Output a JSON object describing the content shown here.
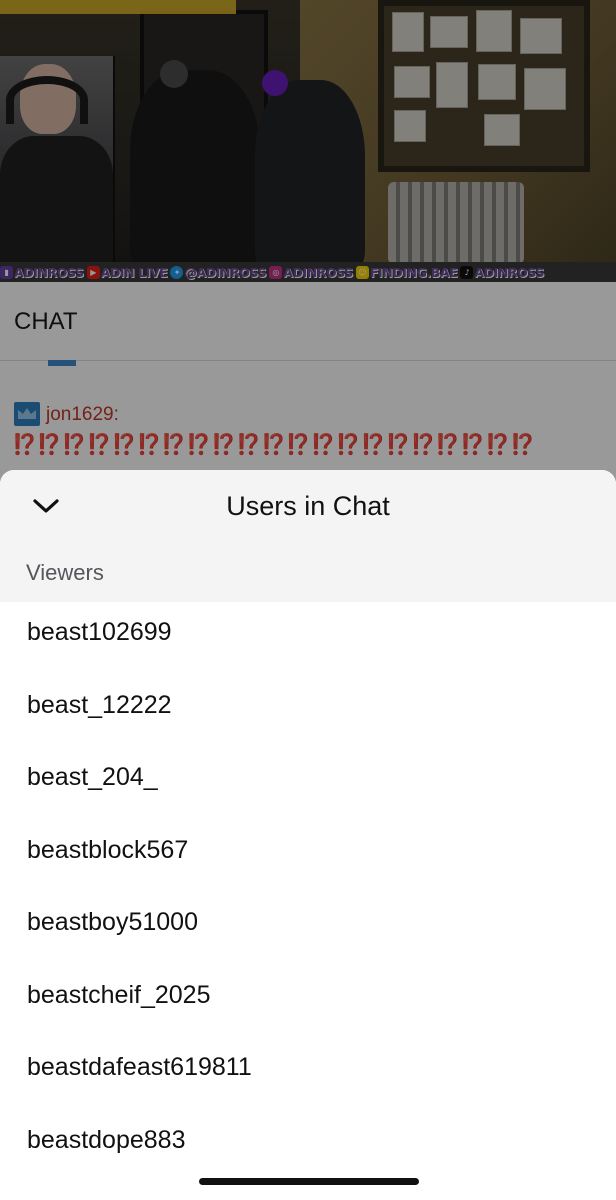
{
  "social_bar": {
    "items": [
      {
        "icon": "twitch-icon",
        "label": "ADINROSS"
      },
      {
        "icon": "youtube-icon",
        "label": "ADIN LIVE"
      },
      {
        "icon": "twitter-icon",
        "label": "@ADINROSS"
      },
      {
        "icon": "instagram-icon",
        "label": "ADINROSS"
      },
      {
        "icon": "snapchat-icon",
        "label": "FINDING.BAE"
      },
      {
        "icon": "tiktok-icon",
        "label": "ADINROSS"
      }
    ]
  },
  "chat": {
    "title": "CHAT",
    "message": {
      "badge_icon": "crown-icon",
      "username": "jon1629:",
      "text": "⁉️⁉️⁉️⁉️⁉️⁉️⁉️⁉️⁉️⁉️⁉️⁉️⁉️⁉️⁉️⁉️⁉️⁉️⁉️⁉️⁉️"
    }
  },
  "sheet": {
    "collapse_icon": "chevron-down-icon",
    "title": "Users in Chat",
    "section_label": "Viewers",
    "users": [
      "beast102699",
      "beast_12222",
      "beast_204_",
      "beastblock567",
      "beastboy51000",
      "beastcheif_2025",
      "beastdafeast619811",
      "beastdope883"
    ]
  },
  "colors": {
    "username": "#c0392b",
    "badge": "#2e7fc1",
    "social_text": "#6b4c9a"
  }
}
